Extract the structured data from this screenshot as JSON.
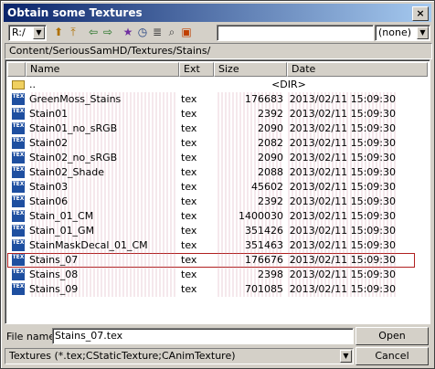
{
  "window": {
    "title": "Obtain some Textures"
  },
  "toolbar": {
    "drive": "R:/",
    "filter": "(none)",
    "path_input": ""
  },
  "path": "Content/SeriousSamHD/Textures/Stains/",
  "columns": {
    "name": "Name",
    "ext": "Ext",
    "size": "Size",
    "date": "Date"
  },
  "parent_row": {
    "name": "..",
    "size": "<DIR>"
  },
  "files": [
    {
      "name": "GreenMoss_Stains",
      "ext": "tex",
      "size": "176683",
      "date": "2013/02/11 15:09:30"
    },
    {
      "name": "Stain01",
      "ext": "tex",
      "size": "2392",
      "date": "2013/02/11 15:09:30"
    },
    {
      "name": "Stain01_no_sRGB",
      "ext": "tex",
      "size": "2090",
      "date": "2013/02/11 15:09:30"
    },
    {
      "name": "Stain02",
      "ext": "tex",
      "size": "2082",
      "date": "2013/02/11 15:09:30"
    },
    {
      "name": "Stain02_no_sRGB",
      "ext": "tex",
      "size": "2090",
      "date": "2013/02/11 15:09:30"
    },
    {
      "name": "Stain02_Shade",
      "ext": "tex",
      "size": "2088",
      "date": "2013/02/11 15:09:30"
    },
    {
      "name": "Stain03",
      "ext": "tex",
      "size": "45602",
      "date": "2013/02/11 15:09:30"
    },
    {
      "name": "Stain06",
      "ext": "tex",
      "size": "2392",
      "date": "2013/02/11 15:09:30"
    },
    {
      "name": "Stain_01_CM",
      "ext": "tex",
      "size": "1400030",
      "date": "2013/02/11 15:09:30"
    },
    {
      "name": "Stain_01_GM",
      "ext": "tex",
      "size": "351426",
      "date": "2013/02/11 15:09:30"
    },
    {
      "name": "StainMaskDecal_01_CM",
      "ext": "tex",
      "size": "351463",
      "date": "2013/02/11 15:09:30"
    },
    {
      "name": "Stains_07",
      "ext": "tex",
      "size": "176676",
      "date": "2013/02/11 15:09:30",
      "selected": true
    },
    {
      "name": "Stains_08",
      "ext": "tex",
      "size": "2398",
      "date": "2013/02/11 15:09:30"
    },
    {
      "name": "Stains_09",
      "ext": "tex",
      "size": "701085",
      "date": "2013/02/11 15:09:30"
    }
  ],
  "footer": {
    "filename_label": "File name:",
    "filename_value": "Stains_07.tex",
    "filetype": "Textures (*.tex;CStaticTexture;CAnimTexture)",
    "open_label": "Open",
    "cancel_label": "Cancel"
  },
  "icons": {
    "tex": "TEX",
    "close": "×"
  }
}
